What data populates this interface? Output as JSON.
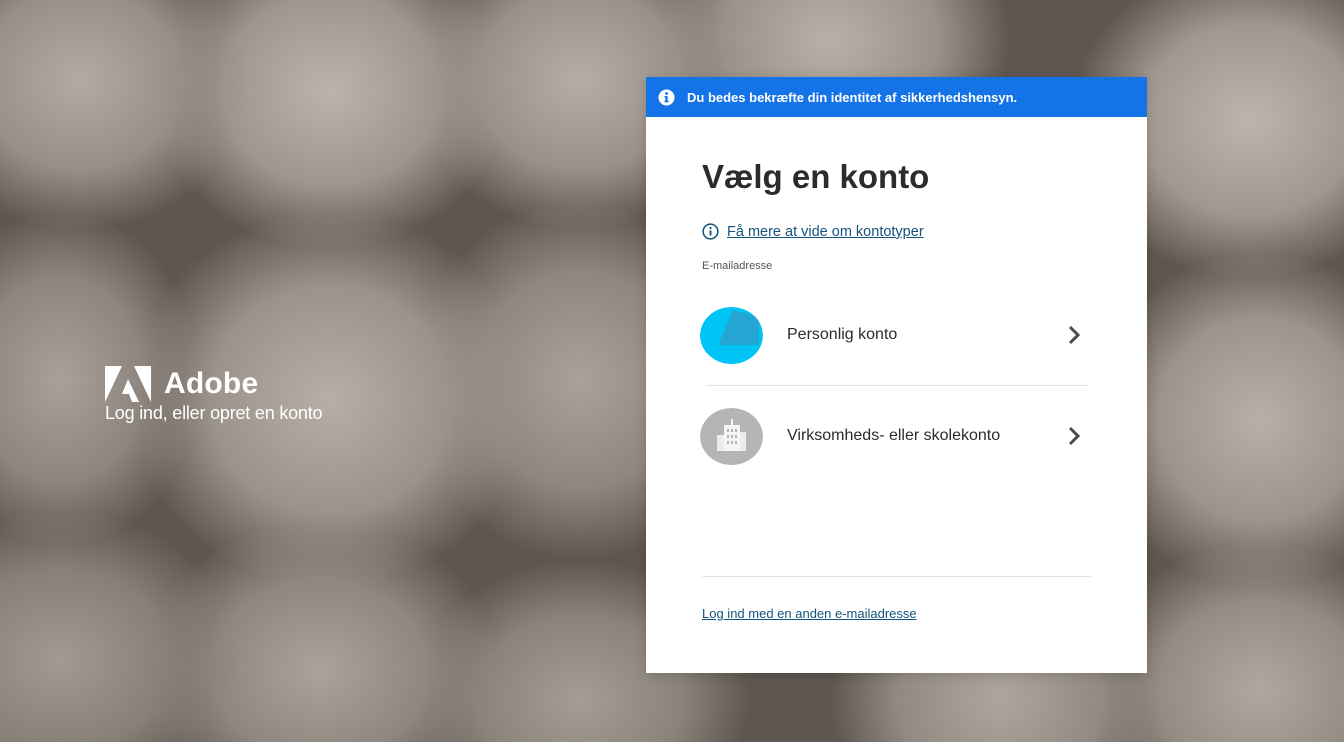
{
  "brand": {
    "name": "Adobe",
    "tagline": "Log ind, eller opret en konto",
    "logo_icon": "adobe-logo-icon"
  },
  "notice": {
    "icon": "info-icon",
    "text": "Du bedes bekræfte din identitet af sikkerhedshensyn.",
    "color": "#1473e6"
  },
  "card": {
    "title": "Vælg en konto",
    "learn_more": {
      "icon": "info-outline-icon",
      "label": "Få mere at vide om kontotyper"
    },
    "email_label": "E-mailadresse",
    "accounts": [
      {
        "label": "Personlig konto",
        "icon": "personal-account-icon",
        "color": "#00c4f5",
        "chevron": "chevron-right-icon"
      },
      {
        "label": "Virksomheds- eller skolekonto",
        "icon": "business-account-icon",
        "color": "#b5b5b5",
        "chevron": "chevron-right-icon"
      }
    ],
    "other_email": "Log ind med en anden e-mailadresse"
  }
}
